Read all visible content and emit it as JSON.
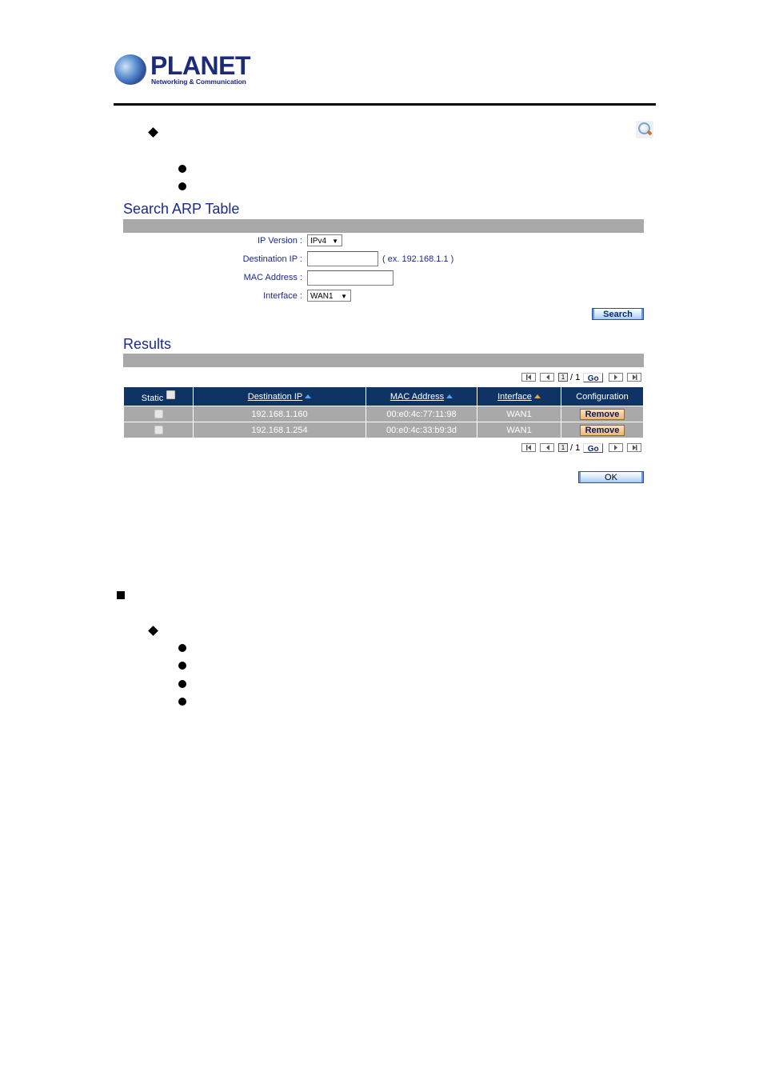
{
  "header": {
    "brand": "PLANET",
    "tagline": "Networking & Communication"
  },
  "icons": {
    "search_icon": "magnifier-icon"
  },
  "search_form": {
    "title": "Search ARP Table",
    "fields": [
      {
        "label": "IP Version :",
        "type": "select",
        "value": "IPv4"
      },
      {
        "label": "Destination IP :",
        "type": "text",
        "value": "",
        "hint": "( ex. 192.168.1.1 )"
      },
      {
        "label": "MAC Address :",
        "type": "text",
        "value": ""
      },
      {
        "label": "Interface :",
        "type": "select",
        "value": "WAN1"
      }
    ],
    "search_button": "Search"
  },
  "results": {
    "title": "Results",
    "pager": {
      "current": "1",
      "total": "/ 1",
      "go_label": "Go"
    },
    "columns": [
      "Static",
      "Destination IP",
      "MAC Address",
      "Interface",
      "Configuration"
    ],
    "rows": [
      {
        "static": false,
        "destination_ip": "192.168.1.160",
        "mac": "00:e0:4c:77:11:98",
        "interface": "WAN1",
        "action": "Remove"
      },
      {
        "static": false,
        "destination_ip": "192.168.1.254",
        "mac": "00:e0:4c:33:b9:3d",
        "interface": "WAN1",
        "action": "Remove"
      }
    ],
    "ok_button": "OK"
  },
  "colors": {
    "header_navy": "#0f3364",
    "title_blue": "#1c2a8a",
    "row_gray": "#a9a9a9",
    "remove_orange": "#eeb672"
  }
}
